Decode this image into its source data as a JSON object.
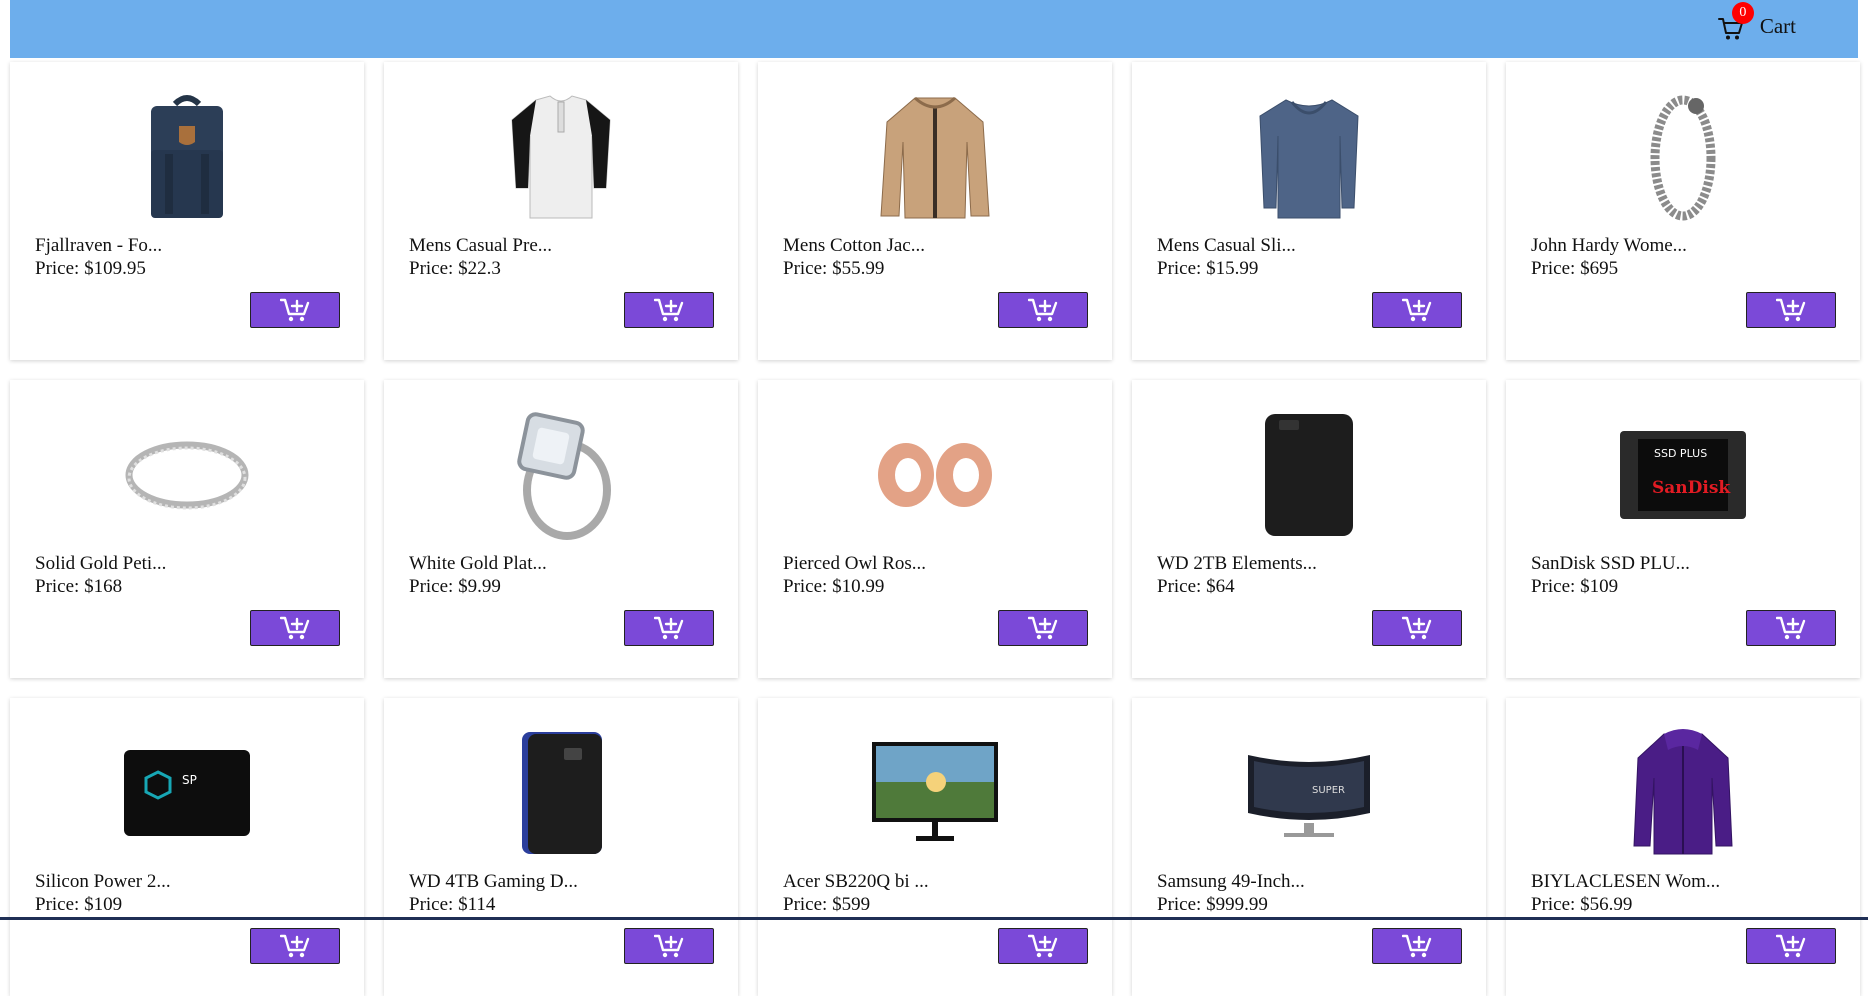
{
  "header": {
    "cart_label": "Cart",
    "cart_count": "0"
  },
  "products": [
    {
      "title": "Fjallraven - Fo...",
      "price": "Price: $109.95",
      "image": "backpack",
      "add_icon": "add-to-cart-icon"
    },
    {
      "title": "Mens Casual Pre...",
      "price": "Price: $22.3",
      "image": "henley-shirt",
      "add_icon": "add-to-cart-icon"
    },
    {
      "title": "Mens Cotton Jac...",
      "price": "Price: $55.99",
      "image": "cotton-jacket",
      "add_icon": "add-to-cart-icon"
    },
    {
      "title": "Mens Casual Sli...",
      "price": "Price: $15.99",
      "image": "long-sleeve-tee",
      "add_icon": "add-to-cart-icon"
    },
    {
      "title": "John Hardy Wome...",
      "price": "Price: $695",
      "image": "chain-bracelet",
      "add_icon": "add-to-cart-icon"
    },
    {
      "title": "Solid Gold Peti...",
      "price": "Price: $168",
      "image": "thin-ring",
      "add_icon": "add-to-cart-icon"
    },
    {
      "title": "White Gold Plat...",
      "price": "Price: $9.99",
      "image": "diamond-ring-set",
      "add_icon": "add-to-cart-icon"
    },
    {
      "title": "Pierced Owl Ros...",
      "price": "Price: $10.99",
      "image": "rose-gold-plugs",
      "add_icon": "add-to-cart-icon"
    },
    {
      "title": "WD 2TB Elements...",
      "price": "Price: $64",
      "image": "external-hard-drive",
      "add_icon": "add-to-cart-icon"
    },
    {
      "title": "SanDisk SSD PLU...",
      "price": "Price: $109",
      "image": "sandisk-ssd",
      "add_icon": "add-to-cart-icon"
    },
    {
      "title": "Silicon Power 2...",
      "price": "Price: $109",
      "image": "silicon-power-ssd",
      "add_icon": "add-to-cart-icon"
    },
    {
      "title": "WD 4TB Gaming D...",
      "price": "Price: $114",
      "image": "gaming-drive",
      "add_icon": "add-to-cart-icon"
    },
    {
      "title": "Acer SB220Q bi ...",
      "price": "Price: $599",
      "image": "acer-monitor",
      "add_icon": "add-to-cart-icon"
    },
    {
      "title": "Samsung 49-Inch...",
      "price": "Price: $999.99",
      "image": "curved-monitor",
      "add_icon": "add-to-cart-icon"
    },
    {
      "title": "BIYLACLESEN Wom...",
      "price": "Price: $56.99",
      "image": "purple-jacket",
      "add_icon": "add-to-cart-icon"
    }
  ],
  "colors": {
    "navbar": "#6daeec",
    "button": "#7b49d8",
    "badge": "#ff0000"
  }
}
